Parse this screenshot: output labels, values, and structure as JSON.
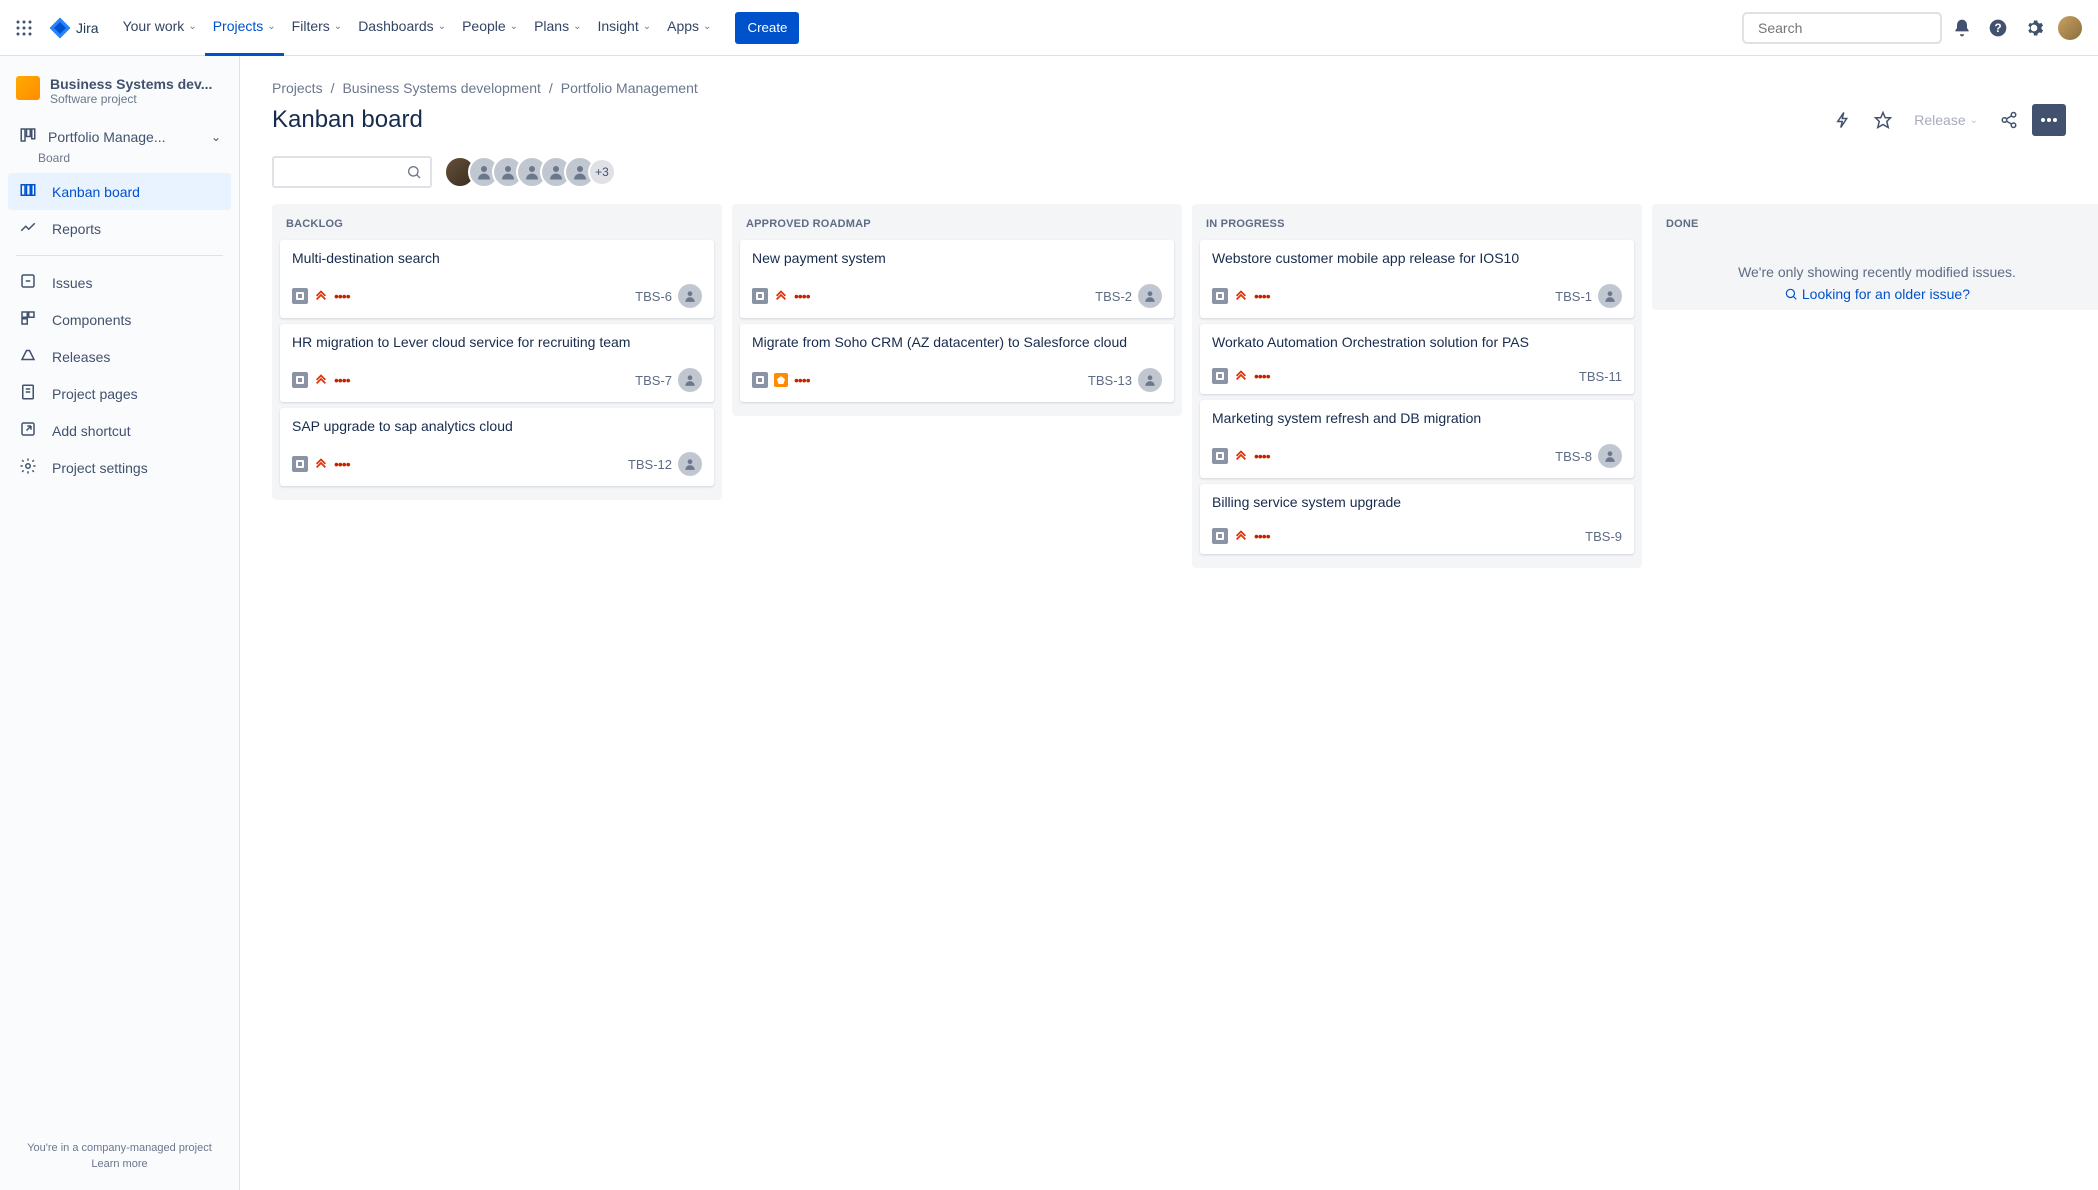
{
  "top_nav": {
    "product": "Jira",
    "items": [
      {
        "label": "Your work",
        "active": false
      },
      {
        "label": "Projects",
        "active": true
      },
      {
        "label": "Filters",
        "active": false
      },
      {
        "label": "Dashboards",
        "active": false
      },
      {
        "label": "People",
        "active": false
      },
      {
        "label": "Plans",
        "active": false
      },
      {
        "label": "Insight",
        "active": false
      },
      {
        "label": "Apps",
        "active": false
      }
    ],
    "create_label": "Create",
    "search_placeholder": "Search"
  },
  "sidebar": {
    "project_name": "Business Systems dev...",
    "project_type": "Software project",
    "board_group": {
      "title": "Portfolio Manage...",
      "subtitle": "Board"
    },
    "items_top": [
      {
        "icon": "board",
        "label": "Kanban board",
        "selected": true
      },
      {
        "icon": "reports",
        "label": "Reports",
        "selected": false
      }
    ],
    "items_bottom": [
      {
        "icon": "issues",
        "label": "Issues"
      },
      {
        "icon": "components",
        "label": "Components"
      },
      {
        "icon": "releases",
        "label": "Releases"
      },
      {
        "icon": "pages",
        "label": "Project pages"
      },
      {
        "icon": "shortcut",
        "label": "Add shortcut"
      },
      {
        "icon": "settings",
        "label": "Project settings"
      }
    ],
    "footer_text": "You're in a company-managed project",
    "footer_link": "Learn more"
  },
  "breadcrumbs": [
    {
      "label": "Projects"
    },
    {
      "label": "Business Systems development"
    },
    {
      "label": "Portfolio Management"
    }
  ],
  "page_title": "Kanban board",
  "header_actions": {
    "release_label": "Release"
  },
  "avatars_overflow": "+3",
  "columns": [
    {
      "title": "BACKLOG",
      "cards": [
        {
          "title": "Multi-destination search",
          "key": "TBS-6",
          "priority": "highest",
          "has_assignee": true,
          "epic": false
        },
        {
          "title": "HR migration to Lever cloud service for recruiting team",
          "key": "TBS-7",
          "priority": "highest",
          "has_assignee": true,
          "epic": false
        },
        {
          "title": "SAP upgrade to sap analytics cloud",
          "key": "TBS-12",
          "priority": "highest",
          "has_assignee": true,
          "epic": false
        }
      ]
    },
    {
      "title": "APPROVED ROADMAP",
      "cards": [
        {
          "title": "New payment system",
          "key": "TBS-2",
          "priority": "highest",
          "has_assignee": true,
          "epic": false
        },
        {
          "title": "Migrate from Soho CRM (AZ datacenter) to Salesforce cloud",
          "key": "TBS-13",
          "priority": "highest",
          "has_assignee": true,
          "epic": true
        }
      ]
    },
    {
      "title": "IN PROGRESS",
      "cards": [
        {
          "title": "Webstore customer mobile app release for IOS10",
          "key": "TBS-1",
          "priority": "highest",
          "has_assignee": true,
          "epic": false
        },
        {
          "title": "Workato Automation Orchestration solution for PAS",
          "key": "TBS-11",
          "priority": "highest",
          "has_assignee": false,
          "epic": false
        },
        {
          "title": "Marketing system refresh and DB migration",
          "key": "TBS-8",
          "priority": "highest",
          "has_assignee": true,
          "epic": false
        },
        {
          "title": "Billing service system upgrade",
          "key": "TBS-9",
          "priority": "highest",
          "has_assignee": false,
          "epic": false
        }
      ]
    },
    {
      "title": "DONE",
      "cards": [],
      "empty_msg": "We're only showing recently modified issues.",
      "empty_link": "Looking for an older issue?"
    }
  ]
}
